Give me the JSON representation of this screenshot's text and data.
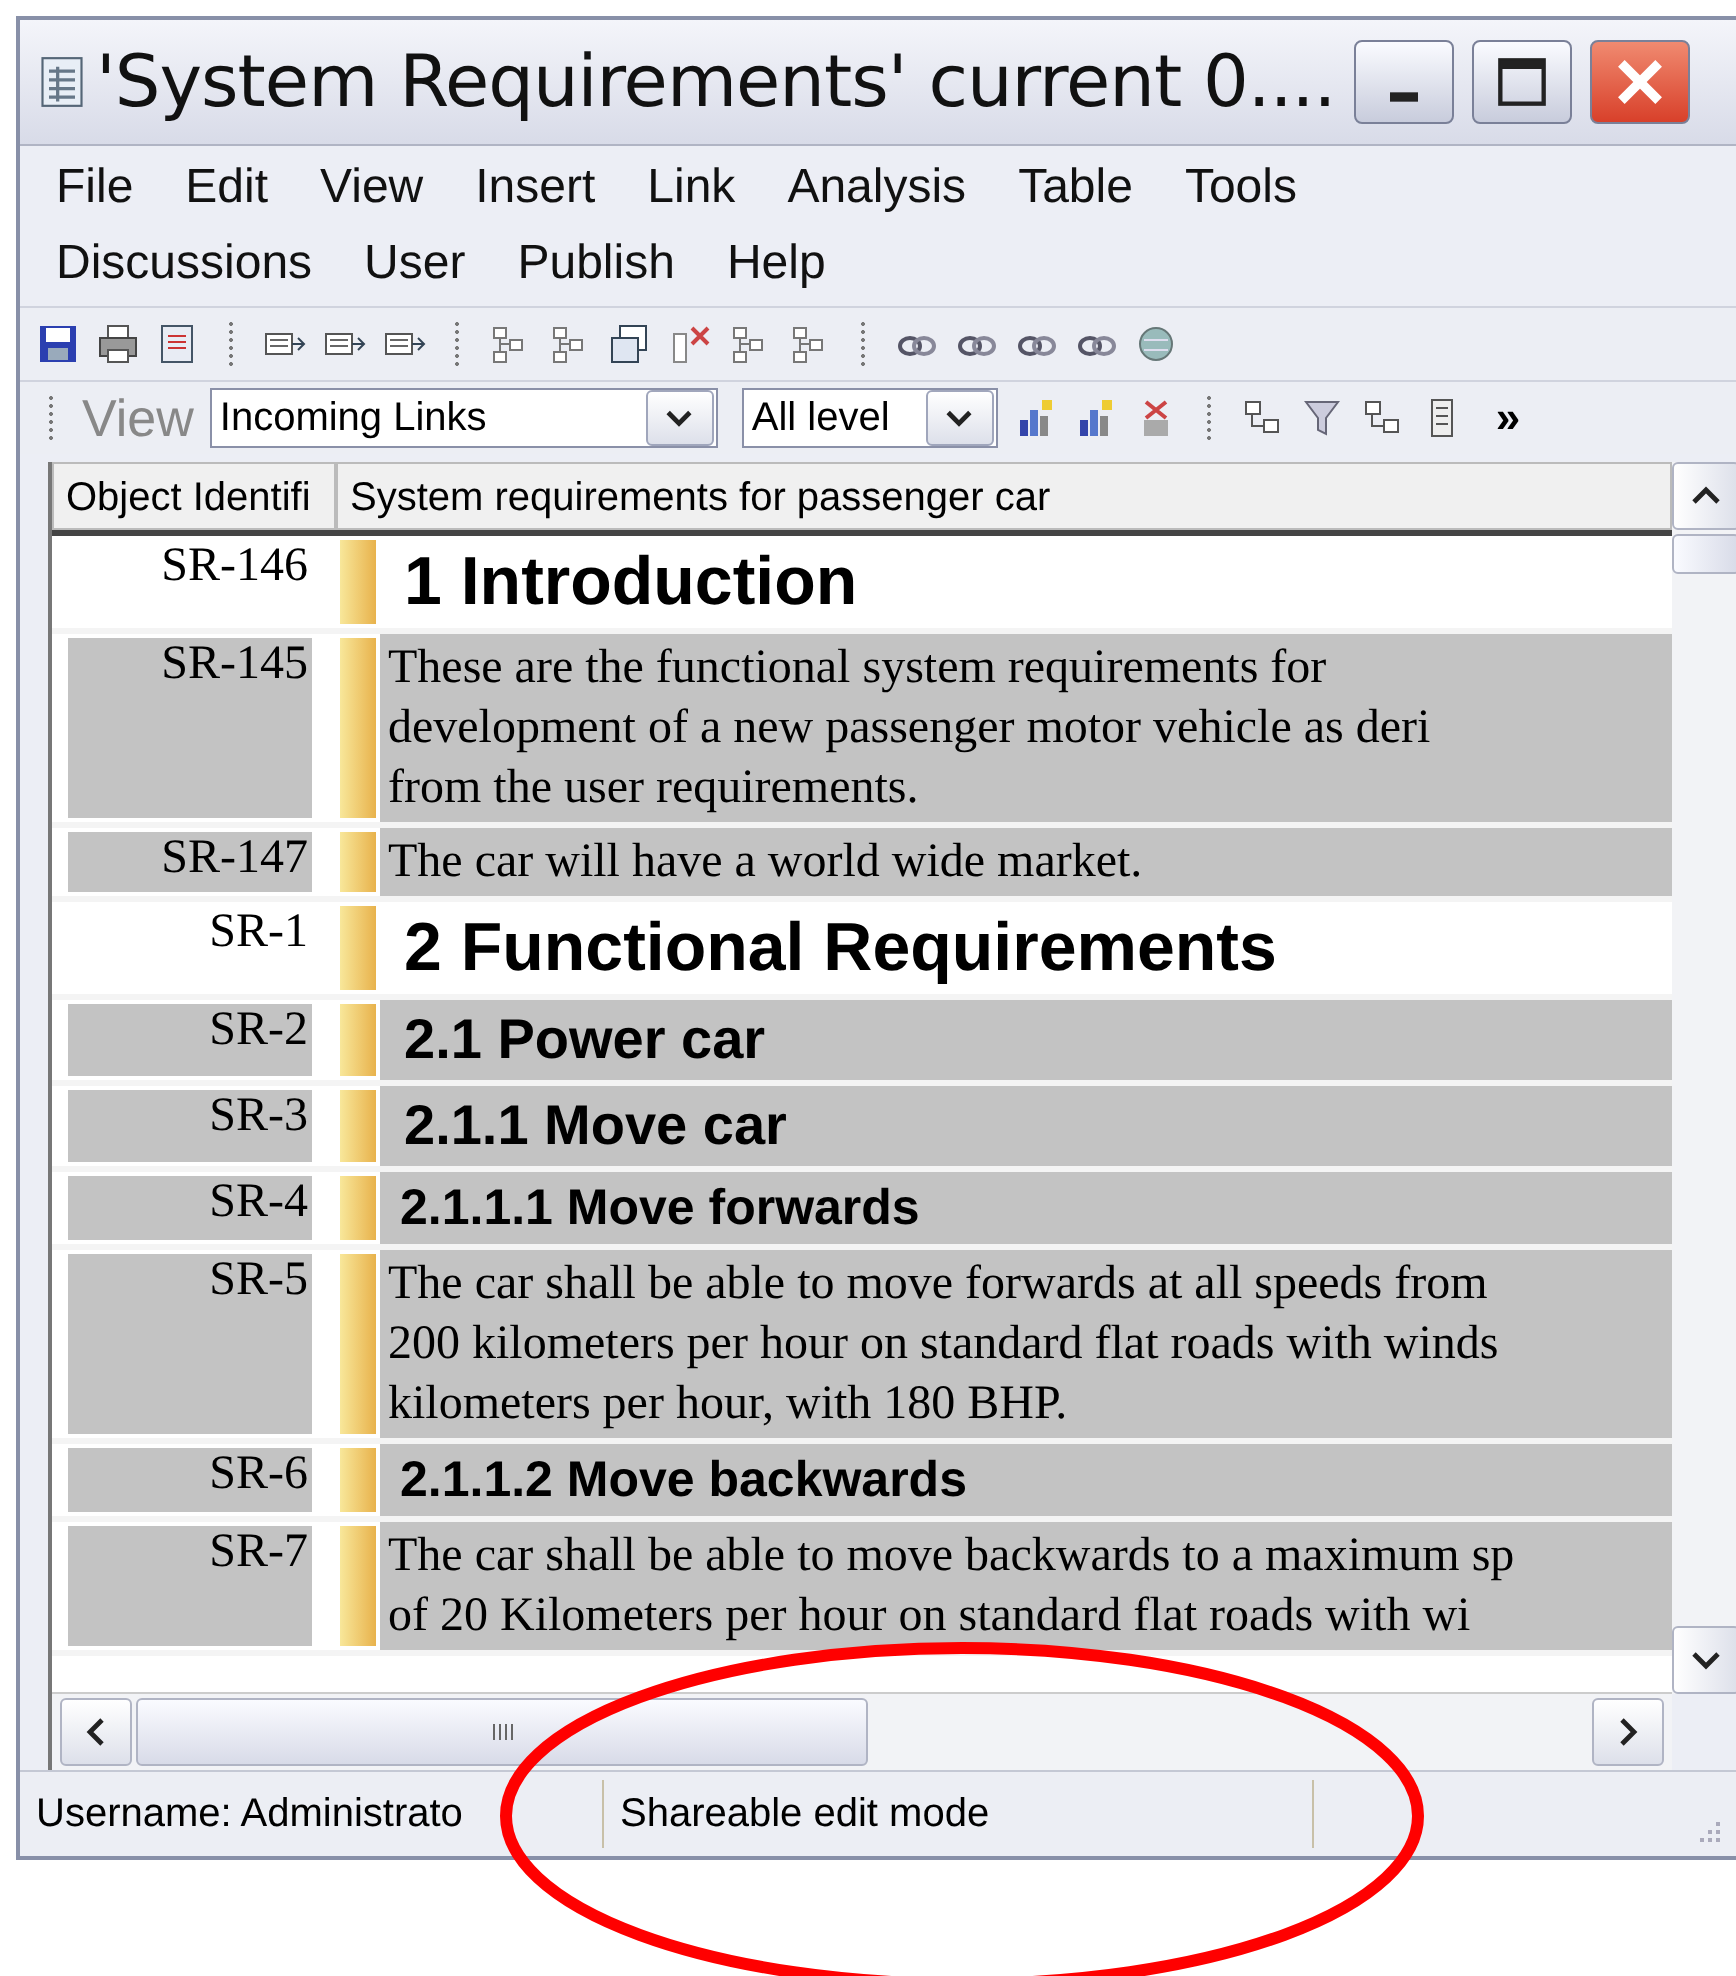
{
  "window": {
    "title": "'System Requirements' current 0...."
  },
  "menu": [
    [
      "File",
      "Edit",
      "View",
      "Insert",
      "Link",
      "Analysis",
      "Table",
      "Tools"
    ],
    [
      "Discussions",
      "User",
      "Publish",
      "Help"
    ]
  ],
  "view_bar": {
    "label": "View",
    "view": "Incoming Links",
    "levels": "All level",
    "more": "»"
  },
  "table": {
    "columns": [
      "Object Identifi",
      "System requirements for passenger car"
    ],
    "rows": [
      {
        "id": "SR-146",
        "kind": "heading1",
        "shaded": false,
        "lines": [
          "1 Introduction"
        ]
      },
      {
        "id": "SR-145",
        "kind": "body",
        "shaded": true,
        "lines": [
          "These are the functional system requirements for",
          "development of a new passenger motor vehicle as deri",
          "from the user requirements."
        ]
      },
      {
        "id": "SR-147",
        "kind": "body",
        "shaded": true,
        "lines": [
          "The car will have a world wide market."
        ]
      },
      {
        "id": "SR-1",
        "kind": "heading1",
        "shaded": false,
        "lines": [
          "2 Functional Requirements"
        ]
      },
      {
        "id": "SR-2",
        "kind": "heading2",
        "shaded": true,
        "lines": [
          "2.1 Power car"
        ]
      },
      {
        "id": "SR-3",
        "kind": "heading2",
        "shaded": true,
        "lines": [
          "2.1.1 Move car"
        ]
      },
      {
        "id": "SR-4",
        "kind": "heading3",
        "shaded": true,
        "lines": [
          "2.1.1.1 Move forwards"
        ]
      },
      {
        "id": "SR-5",
        "kind": "body",
        "shaded": true,
        "lines": [
          "The car shall be able to move forwards at all speeds from",
          "200 kilometers per hour on standard flat roads with winds",
          "kilometers per hour, with 180 BHP."
        ]
      },
      {
        "id": "SR-6",
        "kind": "heading3",
        "shaded": true,
        "lines": [
          "2.1.1.2 Move backwards"
        ]
      },
      {
        "id": "SR-7",
        "kind": "body",
        "shaded": true,
        "lines": [
          "The car shall be able to move backwards to a maximum sp",
          "of 20 Kilometers per hour on standard flat roads with wi"
        ]
      }
    ]
  },
  "status_bar": [
    "Username: Administrato",
    "Shareable edit mode"
  ],
  "annotations": [
    {
      "kind": "ellipse",
      "color": "#ff0000"
    }
  ]
}
